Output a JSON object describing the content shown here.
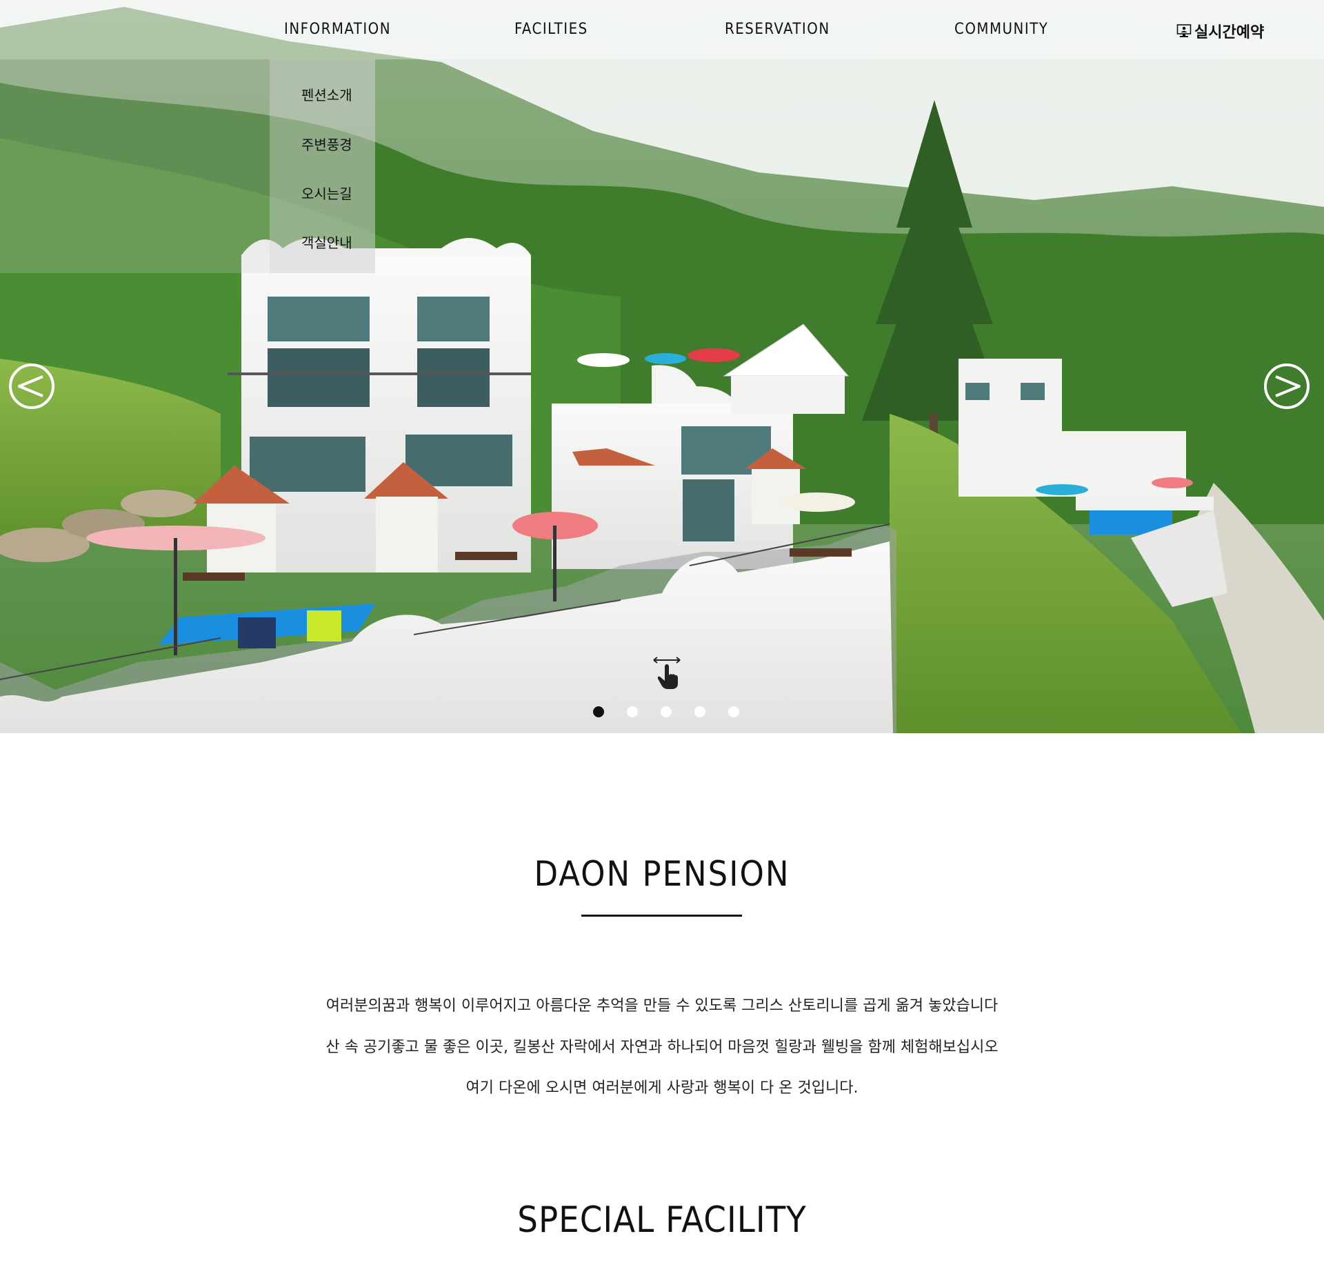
{
  "nav": {
    "items": [
      {
        "label": "INFORMATION"
      },
      {
        "label": "FACILTIES"
      },
      {
        "label": "RESERVATION"
      },
      {
        "label": "COMMUNITY"
      }
    ],
    "booking": {
      "label": "실시간예약",
      "icon": "monitor-person-icon"
    }
  },
  "submenu": {
    "items": [
      {
        "label": "펜션소개"
      },
      {
        "label": "주변풍경"
      },
      {
        "label": "오시는길"
      },
      {
        "label": "객실안내"
      }
    ]
  },
  "slider": {
    "total_slides": 5,
    "active_slide": 1,
    "prev_icon": "chevron-left-circle-icon",
    "next_icon": "chevron-right-circle-icon",
    "swipe_icon": "swipe-hand-icon"
  },
  "about": {
    "title": "DAON PENSION",
    "lines": [
      "여러분의꿈과  행복이 이루어지고 아름다운 추억을 만들 수 있도록 그리스 산토리니를 곱게 옮겨 놓았습니다",
      "산 속 공기좋고 물 좋은 이곳, 킬봉산 자락에서 자연과 하나되어 마음껏 힐랑과 웰빙을 함께 체험해보십시오",
      "여기 다온에 오시면 여러분에게 사랑과 행복이 다 온 것입니다."
    ]
  },
  "facility": {
    "title": "SPECIAL FACILITY"
  },
  "colors": {
    "text": "#111111",
    "background": "#ffffff",
    "pool": "#1a8fe0",
    "building": "#f4f4f2",
    "roof": "#c5603e",
    "forest": "#3f7d2c"
  }
}
